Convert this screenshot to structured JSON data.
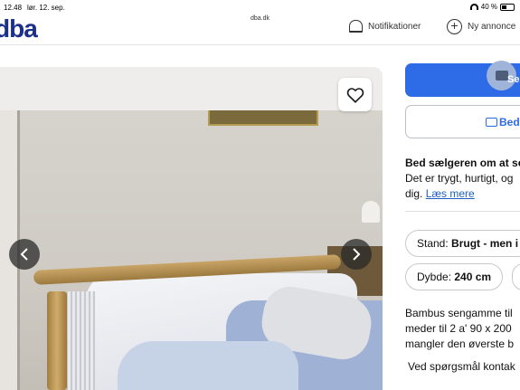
{
  "status_bar": {
    "time": "12.48",
    "date": "lør. 12. sep.",
    "url": "dba.dk",
    "battery": "40 %"
  },
  "header": {
    "logo": "dba",
    "notifications_label": "Notifikationer",
    "new_ad_label": "Ny annonce"
  },
  "gallery": {
    "favorite_icon": "heart-icon",
    "prev_icon": "chevron-left-icon",
    "next_icon": "chevron-right-icon"
  },
  "actions": {
    "primary_label": "Se",
    "secondary_label": "Bed"
  },
  "ask_seller": {
    "title": "Bed sælgeren om at se",
    "line1": "Det er trygt, hurtigt, og",
    "line2_prefix": "dig. ",
    "read_more": "Læs mere"
  },
  "attributes": {
    "stand_label": "Stand: ",
    "stand_value": "Brugt - men i",
    "depth_label": "Dybde: ",
    "depth_value": "240 cm"
  },
  "description": {
    "line1": "Bambus sengamme til",
    "line2": "meder til 2 a' 90 x 200",
    "line3": "mangler den øverste b",
    "line4": "Ved spørgsmål kontak"
  },
  "colors": {
    "brand": "#1c2f8a",
    "primary_button": "#2e6be6",
    "link": "#1f5fc4"
  }
}
